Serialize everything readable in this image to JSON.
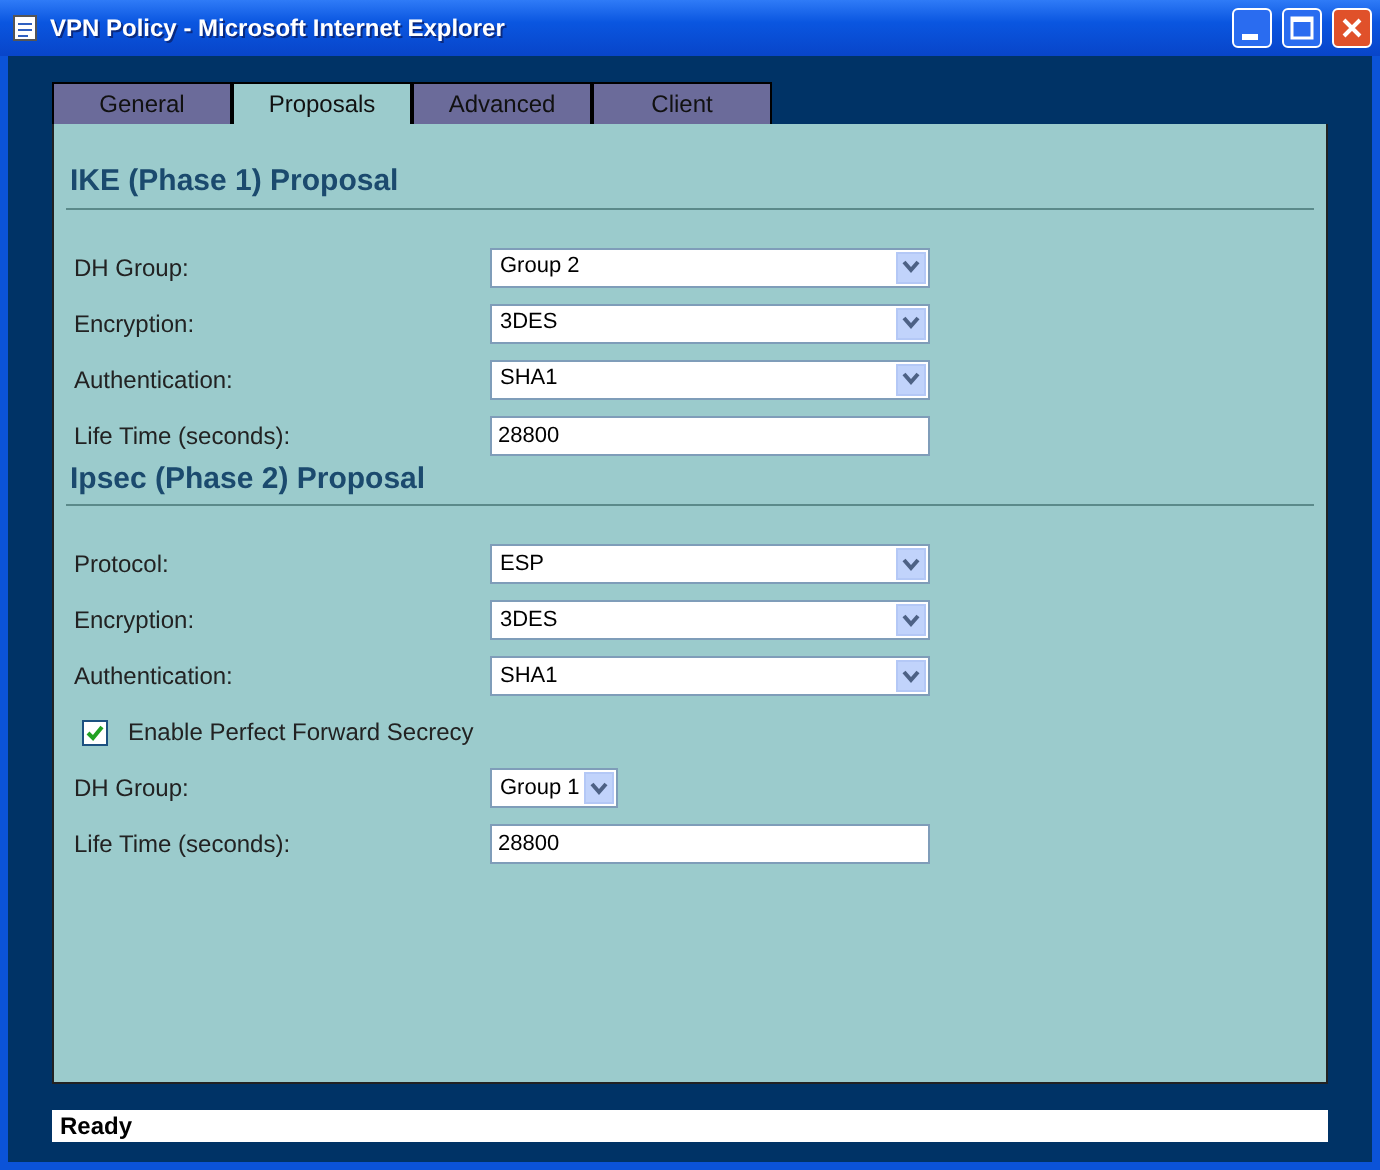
{
  "window": {
    "title": "VPN Policy - Microsoft Internet Explorer"
  },
  "tabs": [
    {
      "label": "General",
      "selected": false
    },
    {
      "label": "Proposals",
      "selected": true
    },
    {
      "label": "Advanced",
      "selected": false
    },
    {
      "label": "Client",
      "selected": false
    }
  ],
  "sections": [
    {
      "title": "IKE (Phase 1) Proposal",
      "fields": [
        {
          "kind": "select",
          "label": "DH Group:",
          "value": "Group 2"
        },
        {
          "kind": "select",
          "label": "Encryption:",
          "value": "3DES"
        },
        {
          "kind": "select",
          "label": "Authentication:",
          "value": "SHA1"
        },
        {
          "kind": "text",
          "label": "Life Time (seconds):",
          "value": "28800"
        }
      ]
    },
    {
      "title": "Ipsec (Phase 2) Proposal",
      "fields": [
        {
          "kind": "select",
          "label": "Protocol:",
          "value": "ESP"
        },
        {
          "kind": "select",
          "label": "Encryption:",
          "value": "3DES"
        },
        {
          "kind": "select",
          "label": "Authentication:",
          "value": "SHA1"
        },
        {
          "kind": "checkbox",
          "label": "Enable Perfect Forward Secrecy",
          "checked": true
        },
        {
          "kind": "short-select",
          "label": "DH Group:",
          "value": "Group 1"
        },
        {
          "kind": "text",
          "label": "Life Time (seconds):",
          "value": "28800"
        }
      ]
    }
  ],
  "status_bar": {
    "text": "Ready"
  }
}
